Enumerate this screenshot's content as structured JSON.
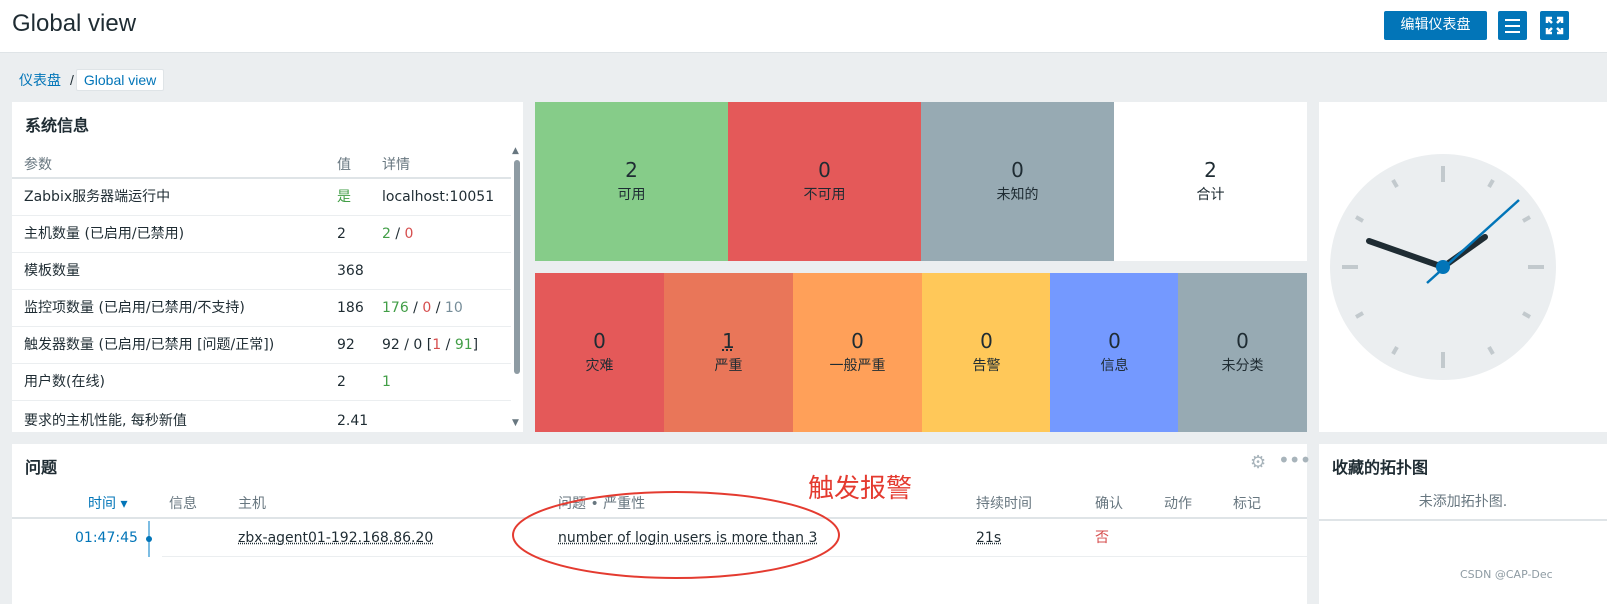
{
  "header": {
    "title": "Global view",
    "edit_label": "编辑仪表盘"
  },
  "breadcrumb": {
    "root": "仪表盘",
    "separator": "/",
    "current": "Global view"
  },
  "system_info": {
    "title": "系统信息",
    "columns": {
      "param": "参数",
      "value": "值",
      "details": "详情"
    },
    "rows": [
      {
        "param": "Zabbix服务器端运行中",
        "value": "是",
        "details": "localhost:10051"
      },
      {
        "param": "主机数量 (已启用/已禁用)",
        "value": "2",
        "d1": "2",
        "s1": " / ",
        "d2": "0"
      },
      {
        "param": "模板数量",
        "value": "368"
      },
      {
        "param": "监控项数量 (已启用/已禁用/不支持)",
        "value": "186",
        "d1": "176",
        "s1": " / ",
        "d2": "0",
        "s2": " / ",
        "d3": "10"
      },
      {
        "param": "触发器数量 (已启用/已禁用 [问题/正常])",
        "value": "92",
        "pre": "92 / 0 [",
        "d1": "1",
        "s1": " / ",
        "d2": "91",
        "post": "]"
      },
      {
        "param": "用户数(在线)",
        "value": "2",
        "details": "1"
      },
      {
        "param": "要求的主机性能, 每秒新值",
        "value": "2.41"
      }
    ]
  },
  "availability": [
    {
      "count": "2",
      "label": "可用",
      "color": "#86cc89"
    },
    {
      "count": "0",
      "label": "不可用",
      "color": "#e45959"
    },
    {
      "count": "0",
      "label": "未知的",
      "color": "#97aab3"
    },
    {
      "count": "2",
      "label": "合计",
      "color": "#ffffff"
    }
  ],
  "severity": [
    {
      "count": "0",
      "label": "灾难",
      "color": "#e45959"
    },
    {
      "count": "1",
      "label": "严重",
      "color": "#e97659"
    },
    {
      "count": "0",
      "label": "一般严重",
      "color": "#ffa059"
    },
    {
      "count": "0",
      "label": "告警",
      "color": "#ffc859"
    },
    {
      "count": "0",
      "label": "信息",
      "color": "#7499ff"
    },
    {
      "count": "0",
      "label": "未分类",
      "color": "#97aab3"
    }
  ],
  "problems": {
    "title": "问题",
    "columns": {
      "time": "时间 ▾",
      "info": "信息",
      "host": "主机",
      "problem": "问题 • 严重性",
      "duration": "持续时间",
      "ack": "确认",
      "actions": "动作",
      "tags": "标记"
    },
    "row": {
      "time": "01:47:45",
      "host": "zbx-agent01-192.168.86.20",
      "problem": "number of login users is more than 3",
      "duration": "21s",
      "ack": "否"
    }
  },
  "favmaps": {
    "title": "收藏的拓扑图",
    "empty": "未添加拓扑图."
  },
  "annotation": "触发报警",
  "watermark": "CSDN @CAP-Dec"
}
